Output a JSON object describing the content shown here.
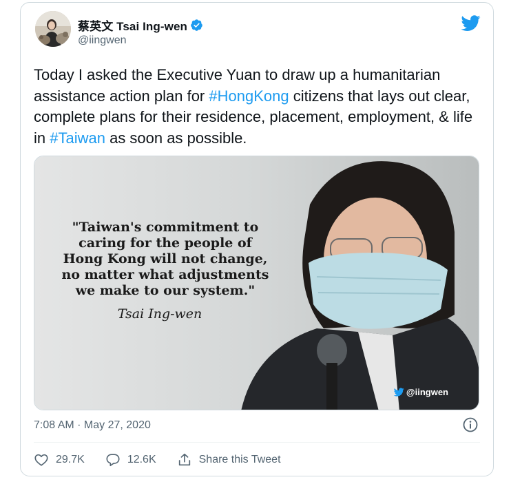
{
  "author": {
    "display_name": "蔡英文 Tsai Ing-wen",
    "handle": "@iingwen",
    "verified": true
  },
  "tweet": {
    "text_parts": [
      "Today I asked the Executive Yuan to draw up a humanitarian assistance action plan for ",
      "#HongKong",
      " citizens that lays out clear, complete plans for their residence, placement, employment, & life in ",
      "#Taiwan",
      " as soon as possible."
    ]
  },
  "media": {
    "quote_lines": [
      "\"Taiwan's commitment to",
      "caring for the people of",
      "Hong Kong will not change,",
      "no matter what adjustments",
      "we make to our system.\""
    ],
    "quote_author": "Tsai Ing-wen",
    "watermark": "@iingwen"
  },
  "meta": {
    "timestamp": "7:08 AM · May 27, 2020"
  },
  "actions": {
    "like_count": "29.7K",
    "reply_count": "12.6K",
    "share_label": "Share this Tweet"
  },
  "colors": {
    "brand": "#1d9bf0",
    "text": "#0f1419",
    "secondary": "#536471",
    "border": "#cfd9de"
  },
  "icons": [
    "cat-avatar",
    "verified-badge-icon",
    "twitter-bird-icon",
    "info-icon",
    "heart-icon",
    "reply-bubble-icon",
    "share-icon"
  ]
}
